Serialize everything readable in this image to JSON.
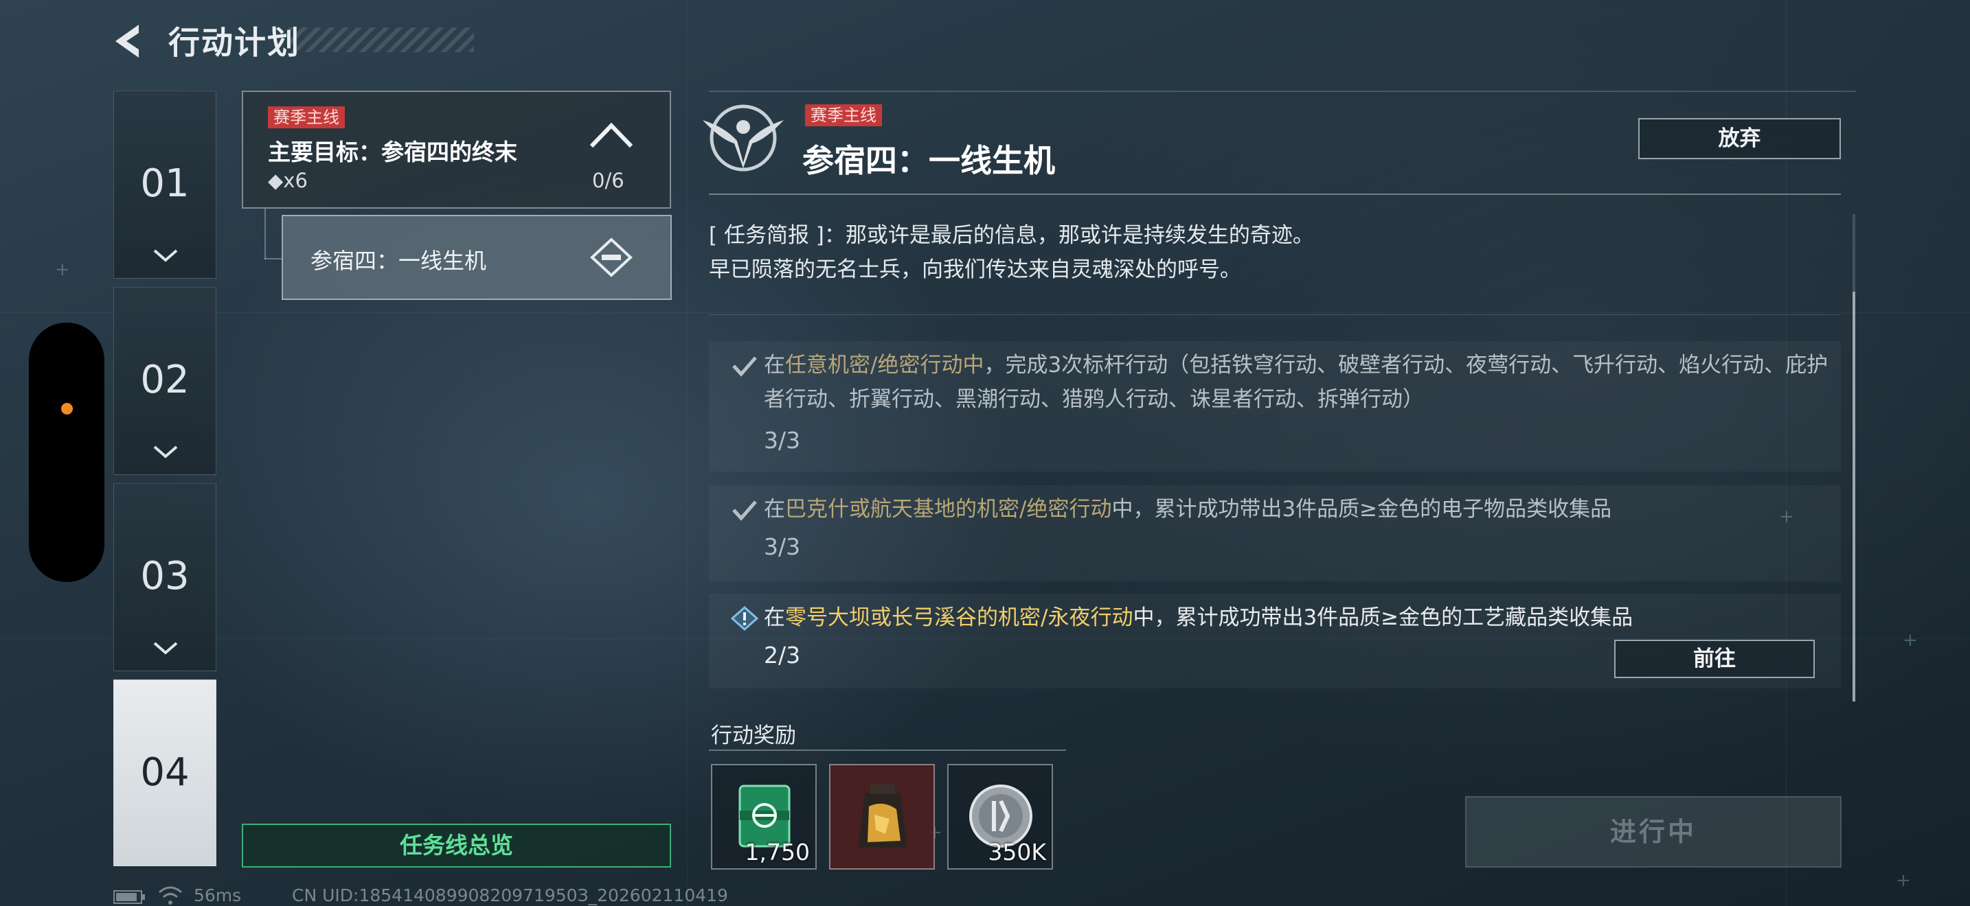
{
  "header": {
    "title": "行动计划",
    "back_icon": "back-arrow-icon"
  },
  "chapters": [
    {
      "num": "01",
      "active": false
    },
    {
      "num": "02",
      "active": false
    },
    {
      "num": "03",
      "active": false
    },
    {
      "num": "04",
      "active": true
    }
  ],
  "quest": {
    "tag": "赛季主线",
    "main_target": "主要目标：参宿四的终末",
    "reward": "◆x6",
    "progress": "0/6",
    "sub_quest": "参宿四：一线生机"
  },
  "overview_button": "任务线总览",
  "detail": {
    "tag": "赛季主线",
    "title": "参宿四：一线生机",
    "abandon_button": "放弃",
    "brief_line1": "[ 任务简报 ]：那或许是最后的信息，那或许是持续发生的奇迹。",
    "brief_line2": "早已陨落的无名士兵，向我们传达来自灵魂深处的呼号。",
    "tasks": [
      {
        "prefix": "在",
        "highlight": "任意机密/绝密行动中",
        "suffix": "，完成3次标杆行动（包括铁穹行动、破壁者行动、夜莺行动、飞升行动、焰火行动、庇护者行动、折翼行动、黑潮行动、猎鸦人行动、诛星者行动、拆弹行动）",
        "count": "3/3",
        "status": "done"
      },
      {
        "prefix": "在",
        "highlight": "巴克什或航天基地的机密/绝密行动",
        "suffix": "中，累计成功带出3件品质≥金色的电子物品类收集品",
        "count": "3/3",
        "status": "done"
      },
      {
        "prefix": "在",
        "highlight": "零号大坝或长弓溪谷的机密/永夜行动",
        "suffix": "中，累计成功带出3件品质≥金色的工艺藏品类收集品",
        "count": "2/3",
        "status": "active",
        "button": "前往"
      }
    ]
  },
  "rewards": {
    "label": "行动奖励",
    "items": [
      {
        "icon": "supply-crate-icon",
        "amount": "1,750"
      },
      {
        "icon": "gold-bag-icon",
        "amount": ""
      },
      {
        "icon": "silver-coin-icon",
        "amount": "350K"
      }
    ]
  },
  "progress_button": "进行中",
  "status_bar": {
    "ping": "56ms",
    "uid": "CN UID:18541408990820971950З_202602110419"
  },
  "colors": {
    "accent_green": "#3fae7a",
    "tag_red": "#c43a3a",
    "highlight_gold": "#f2cf6a",
    "indicator_orange": "#f08a24"
  }
}
